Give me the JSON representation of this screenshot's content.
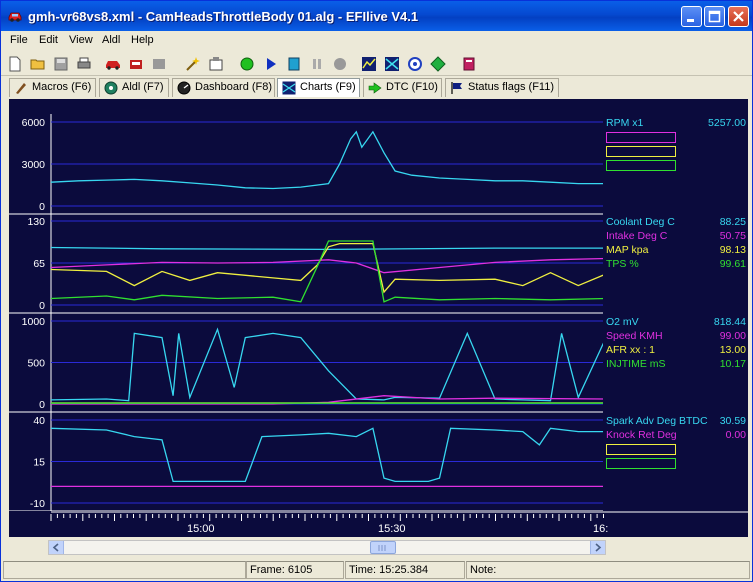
{
  "window": {
    "title": "gmh-vr68vs8.xml - CamHeadsThrottleBody 01.alg - EFIlive V4.1"
  },
  "menu": [
    "File",
    "Edit",
    "View",
    "Aldl",
    "Help"
  ],
  "tabs": [
    {
      "label": "Macros (F6)",
      "icon": "macros-icon"
    },
    {
      "label": "Aldl (F7)",
      "icon": "aldl-icon"
    },
    {
      "label": "Dashboard (F8)",
      "icon": "dashboard-icon"
    },
    {
      "label": "Charts (F9)",
      "icon": "charts-icon",
      "active": true
    },
    {
      "label": "DTC (F10)",
      "icon": "dtc-icon"
    },
    {
      "label": "Status flags (F11)",
      "icon": "status-flags-icon"
    }
  ],
  "colors": {
    "cyan": "#37d7f0",
    "magenta": "#e030e0",
    "yellow": "#f0f040",
    "green": "#30e030",
    "background": "#0b0b3d",
    "grid": "#2a2ad8"
  },
  "panels": [
    {
      "yticks": [
        "6000",
        "3000",
        "0"
      ],
      "ymin": 0,
      "ymax": 6000,
      "legend": [
        {
          "name": "RPM x1",
          "value": "5257.00",
          "color": "#37d7f0"
        },
        {
          "name": "",
          "value": "",
          "color": "#e030e0"
        },
        {
          "name": "",
          "value": "",
          "color": "#f0f040"
        },
        {
          "name": "",
          "value": "",
          "color": "#30e030"
        }
      ]
    },
    {
      "yticks": [
        "130",
        "65",
        "0"
      ],
      "ymin": 0,
      "ymax": 130,
      "legend": [
        {
          "name": "Coolant Deg C",
          "value": "88.25",
          "color": "#37d7f0"
        },
        {
          "name": "Intake Deg C",
          "value": "50.75",
          "color": "#e030e0"
        },
        {
          "name": "MAP kpa",
          "value": "98.13",
          "color": "#f0f040"
        },
        {
          "name": "TPS %",
          "value": "99.61",
          "color": "#30e030"
        }
      ]
    },
    {
      "yticks": [
        "1000",
        "500",
        "0"
      ],
      "ymin": 0,
      "ymax": 1000,
      "legend": [
        {
          "name": "O2 mV",
          "value": "818.44",
          "color": "#37d7f0"
        },
        {
          "name": "Speed KMH",
          "value": "99.00",
          "color": "#e030e0"
        },
        {
          "name": "AFR xx : 1",
          "value": "13.00",
          "color": "#f0f040"
        },
        {
          "name": "INJTIME mS",
          "value": "10.17",
          "color": "#30e030"
        }
      ]
    },
    {
      "yticks": [
        "40",
        "15",
        "-10"
      ],
      "ymin": -10,
      "ymax": 40,
      "legend": [
        {
          "name": "Spark Adv Deg BTDC",
          "value": "30.59",
          "color": "#37d7f0"
        },
        {
          "name": "Knock Ret Deg",
          "value": "0.00",
          "color": "#e030e0"
        },
        {
          "name": "",
          "value": "",
          "color": "#f0f040"
        },
        {
          "name": "",
          "value": "",
          "color": "#30e030"
        }
      ]
    }
  ],
  "time_axis": [
    "15:00",
    "15:30",
    "16:"
  ],
  "status": {
    "frame": "Frame: 6105",
    "time": "Time: 15:25.384",
    "note": "Note:"
  },
  "chart_data": {
    "type": "line",
    "x_range": [
      "14:50",
      "16:00"
    ],
    "series": [
      {
        "name": "RPM x1",
        "panel": 0,
        "x": [
          0,
          0.05,
          0.1,
          0.15,
          0.2,
          0.25,
          0.3,
          0.35,
          0.4,
          0.45,
          0.5,
          0.52,
          0.54,
          0.55,
          0.56,
          0.58,
          0.6,
          0.62,
          0.65,
          0.7,
          0.75,
          0.8,
          0.85,
          0.9,
          0.95,
          1.0
        ],
        "y": [
          1700,
          1800,
          1850,
          1900,
          1800,
          1650,
          1500,
          1300,
          1250,
          1350,
          1600,
          3000,
          4800,
          5300,
          4200,
          5300,
          3800,
          2500,
          2200,
          2000,
          1900,
          1800,
          1800,
          1700,
          1600,
          1600
        ]
      },
      {
        "name": "Coolant Deg C",
        "panel": 1,
        "x": [
          0,
          0.2,
          0.5,
          0.8,
          1.0
        ],
        "y": [
          89,
          87,
          86,
          88,
          88
        ]
      },
      {
        "name": "Intake Deg C",
        "panel": 1,
        "x": [
          0,
          0.1,
          0.2,
          0.3,
          0.4,
          0.5,
          0.55,
          0.6,
          0.7,
          0.8,
          0.9,
          1.0
        ],
        "y": [
          58,
          62,
          66,
          65,
          66,
          70,
          65,
          50,
          58,
          66,
          70,
          72
        ]
      },
      {
        "name": "MAP kpa",
        "panel": 1,
        "x": [
          0,
          0.1,
          0.15,
          0.2,
          0.25,
          0.3,
          0.4,
          0.45,
          0.48,
          0.5,
          0.52,
          0.55,
          0.58,
          0.6,
          0.62,
          0.7,
          0.8,
          0.85,
          0.9,
          0.95,
          1.0
        ],
        "y": [
          55,
          52,
          30,
          52,
          38,
          50,
          42,
          38,
          62,
          90,
          95,
          95,
          95,
          20,
          40,
          38,
          40,
          30,
          50,
          30,
          48
        ]
      },
      {
        "name": "TPS %",
        "panel": 1,
        "x": [
          0,
          0.1,
          0.15,
          0.2,
          0.3,
          0.4,
          0.45,
          0.48,
          0.5,
          0.52,
          0.55,
          0.58,
          0.6,
          0.62,
          0.7,
          0.8,
          0.9,
          1.0
        ],
        "y": [
          10,
          14,
          8,
          15,
          10,
          12,
          5,
          60,
          99,
          99,
          99,
          99,
          5,
          12,
          8,
          10,
          8,
          10
        ]
      },
      {
        "name": "O2 mV",
        "panel": 2,
        "x": [
          0,
          0.1,
          0.14,
          0.15,
          0.2,
          0.22,
          0.23,
          0.25,
          0.3,
          0.33,
          0.35,
          0.4,
          0.45,
          0.5,
          0.55,
          0.6,
          0.62,
          0.7,
          0.75,
          0.8,
          0.85,
          0.9,
          0.92,
          0.95,
          1.0
        ],
        "y": [
          50,
          60,
          40,
          850,
          800,
          100,
          850,
          80,
          900,
          200,
          800,
          850,
          800,
          400,
          60,
          50,
          80,
          70,
          850,
          60,
          50,
          40,
          850,
          80,
          800
        ]
      },
      {
        "name": "Speed KMH",
        "panel": 2,
        "x": [
          0,
          0.2,
          0.4,
          0.5,
          0.6,
          0.7,
          0.8,
          1.0
        ],
        "y": [
          0,
          0,
          0,
          20,
          100,
          60,
          70,
          60
        ]
      },
      {
        "name": "AFR xx : 1",
        "panel": 2,
        "x": [
          0,
          1.0
        ],
        "y": [
          13,
          13
        ]
      },
      {
        "name": "INJTIME mS",
        "panel": 2,
        "x": [
          0,
          0.5,
          1.0
        ],
        "y": [
          10,
          10,
          10
        ]
      },
      {
        "name": "Spark Adv Deg BTDC",
        "panel": 3,
        "x": [
          0,
          0.1,
          0.15,
          0.2,
          0.22,
          0.3,
          0.35,
          0.38,
          0.45,
          0.5,
          0.55,
          0.58,
          0.6,
          0.62,
          0.68,
          0.7,
          0.72,
          0.8,
          0.85,
          0.88,
          0.9,
          0.95,
          1.0
        ],
        "y": [
          35,
          34,
          30,
          28,
          3,
          3,
          3,
          30,
          31,
          32,
          30,
          35,
          5,
          3,
          3,
          5,
          35,
          34,
          33,
          25,
          35,
          33,
          33
        ]
      },
      {
        "name": "Knock Ret Deg",
        "panel": 3,
        "x": [
          0,
          1.0
        ],
        "y": [
          0,
          0
        ]
      }
    ]
  }
}
